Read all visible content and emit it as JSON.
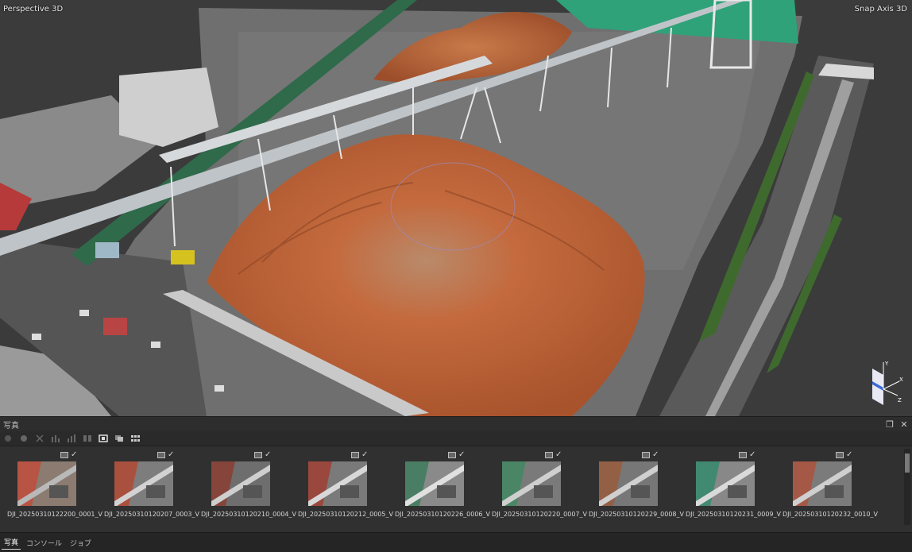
{
  "viewport": {
    "view_mode": "Perspective 3D",
    "snap_axis": "Snap Axis 3D",
    "axis_labels": {
      "x": "X",
      "y": "Y",
      "z": "Z"
    }
  },
  "photo_panel": {
    "title": "写真",
    "toolbar_icons": [
      "circle-filled-icon",
      "circle-icon",
      "close-x-icon",
      "chart-icon",
      "chart-icon-2",
      "split-icon",
      "frame-icon",
      "overlay-icon",
      "grid-dropdown-icon"
    ],
    "photos": [
      {
        "name": "DJI_20250310122200_0001_V"
      },
      {
        "name": "DJI_20250310120207_0003_V"
      },
      {
        "name": "DJI_20250310120210_0004_V"
      },
      {
        "name": "DJI_20250310120212_0005_V"
      },
      {
        "name": "DJI_20250310120226_0006_V"
      },
      {
        "name": "DJI_20250310120220_0007_V"
      },
      {
        "name": "DJI_20250310120229_0008_V"
      },
      {
        "name": "DJI_20250310120231_0009_V"
      },
      {
        "name": "DJI_20250310120232_0010_V"
      }
    ]
  },
  "bottom_tabs": [
    "写真",
    "コンソール",
    "ジョブ"
  ],
  "colors": {
    "accent_pile": "#c2653b",
    "panel_bg": "#303030"
  }
}
